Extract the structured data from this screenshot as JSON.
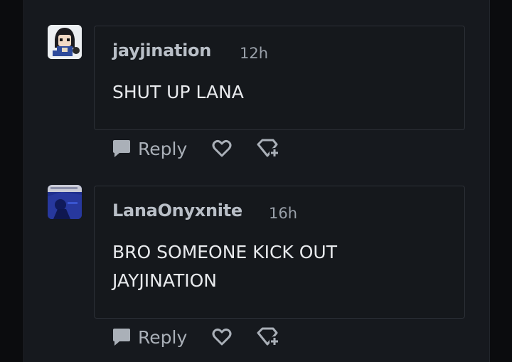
{
  "comments": [
    {
      "username": "jayjination",
      "time": "12h",
      "text": "SHUT UP LANA",
      "reply_label": "Reply",
      "avatar": "cartoon-character-avatar"
    },
    {
      "username": "LanaOnyxnite",
      "time": "16h",
      "text_lines": [
        "BRO SOMEONE KICK OUT",
        "JAYJINATION"
      ],
      "reply_label": "Reply",
      "avatar": "blue-scene-avatar"
    }
  ],
  "icons": {
    "reply": "chat-bubble-icon",
    "like": "heart-icon",
    "award": "gem-plus-icon"
  },
  "colors": {
    "background": "#0b0c0e",
    "panel": "#16191e",
    "card_border": "#2c3037",
    "text": "#e8eaed",
    "muted": "#9aa1aa"
  }
}
